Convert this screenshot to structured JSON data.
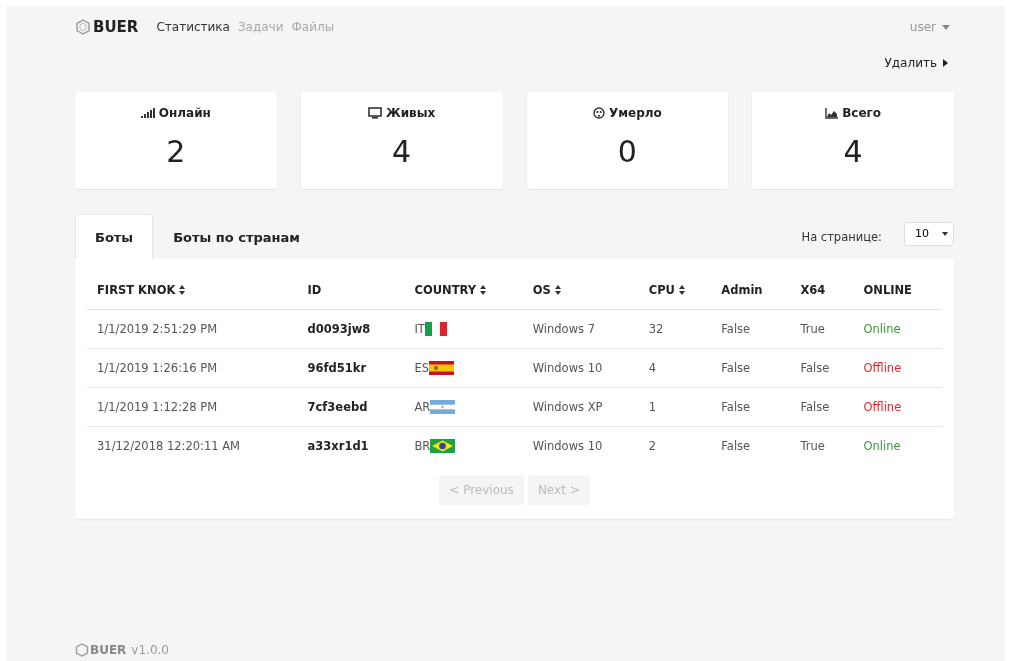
{
  "brand": {
    "name": "BUER"
  },
  "nav": [
    {
      "label": "Статистика",
      "selected": true
    },
    {
      "label": "Задачи",
      "selected": false
    },
    {
      "label": "Файлы",
      "selected": false
    }
  ],
  "user_menu": {
    "label": "user"
  },
  "delete_button": {
    "label": "Удалить"
  },
  "stats": [
    {
      "kind": "signal",
      "label": "Онлайн",
      "value": "2"
    },
    {
      "kind": "monitor",
      "label": "Живых",
      "value": "4"
    },
    {
      "kind": "skull",
      "label": "Умерло",
      "value": "0"
    },
    {
      "kind": "chart",
      "label": "Всего",
      "value": "4"
    }
  ],
  "tabs": [
    {
      "label": "Боты",
      "selected": true
    },
    {
      "label": "Боты по странам",
      "selected": false
    }
  ],
  "page_size": {
    "label": "На странице:",
    "value": "10"
  },
  "table": {
    "columns": [
      {
        "label": "FIRST KNOK",
        "sortable": true
      },
      {
        "label": "ID",
        "sortable": false
      },
      {
        "label": "COUNTRY",
        "sortable": true
      },
      {
        "label": "OS",
        "sortable": true
      },
      {
        "label": "CPU",
        "sortable": true
      },
      {
        "label": "Admin",
        "sortable": false
      },
      {
        "label": "X64",
        "sortable": false
      },
      {
        "label": "ONLINE",
        "sortable": false
      }
    ],
    "rows": [
      {
        "first_knok": "1/1/2019 2:51:29 PM",
        "id": "d0093jw8",
        "country": "IT",
        "kind": "italy",
        "os": "Windows 7",
        "cpu": "32",
        "admin": "False",
        "x64": "True",
        "status": "Online",
        "online": true
      },
      {
        "first_knok": "1/1/2019 1:26:16 PM",
        "id": "96fd51kr",
        "country": "ES",
        "kind": "spain",
        "os": "Windows 10",
        "cpu": "4",
        "admin": "False",
        "x64": "False",
        "status": "Offline",
        "online": false
      },
      {
        "first_knok": "1/1/2019 1:12:28 PM",
        "id": "7cf3eebd",
        "country": "AR",
        "kind": "argentina",
        "os": "Windows XP",
        "cpu": "1",
        "admin": "False",
        "x64": "False",
        "status": "Offline",
        "online": false
      },
      {
        "first_knok": "31/12/2018 12:20:11 AM",
        "id": "a33xr1d1",
        "country": "BR",
        "kind": "brazil",
        "os": "Windows 10",
        "cpu": "2",
        "admin": "False",
        "x64": "True",
        "status": "Online",
        "online": true
      }
    ]
  },
  "pagination": [
    {
      "label": "< Previous",
      "disabled": true
    },
    {
      "label": "Next >",
      "disabled": true
    }
  ],
  "footer": {
    "brand": "BUER",
    "version": "v1.0.0"
  }
}
